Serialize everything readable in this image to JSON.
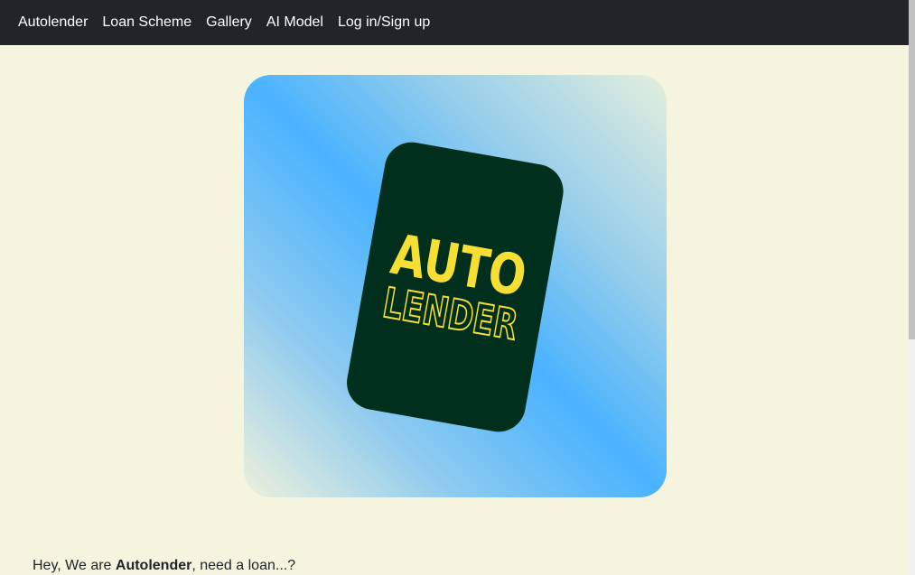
{
  "navbar": {
    "brand": "Autolender",
    "items": [
      {
        "label": "Loan Scheme"
      },
      {
        "label": "Gallery"
      },
      {
        "label": "AI Model"
      },
      {
        "label": "Log in/Sign up"
      }
    ]
  },
  "hero": {
    "logo_line1": "AUTO",
    "logo_line2": "LENDER",
    "colors": {
      "card": "#002f1d",
      "logo_text": "#f5df32",
      "gradient_center": "#4ab3ff",
      "gradient_edge": "#eef1dc"
    }
  },
  "intro": {
    "prefix": "Hey, We are ",
    "brand": "Autolender",
    "suffix": ", need a loan...?"
  }
}
